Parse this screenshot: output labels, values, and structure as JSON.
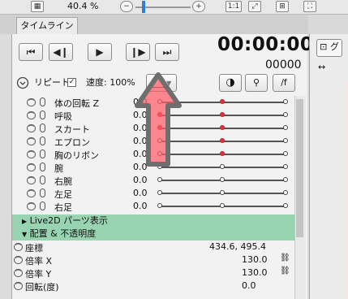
{
  "toolbar": {
    "zoom_label": "40.4 %",
    "ratio_label": "1:1"
  },
  "tabs": {
    "timeline": "タイムライン"
  },
  "player": {
    "timecode": "00:00:00",
    "frame": "00000"
  },
  "options": {
    "repeat_label": "リピート",
    "speed_label": "速度: 100%",
    "f_label": "/f"
  },
  "tracks": [
    {
      "label": "体の回転 Z",
      "value": "0.0"
    },
    {
      "label": "呼吸",
      "value": "0.0"
    },
    {
      "label": "スカート",
      "value": "0.0"
    },
    {
      "label": "エプロン",
      "value": "0.0"
    },
    {
      "label": "胸のリボン",
      "value": "0.0"
    },
    {
      "label": "腕",
      "value": "0.0"
    },
    {
      "label": "右腕",
      "value": "0.0"
    },
    {
      "label": "左足",
      "value": "0.0"
    },
    {
      "label": "右足",
      "value": "0.0"
    }
  ],
  "sections": {
    "live2d": "Live2D パーツ表示",
    "placement": "配置 & 不透明度"
  },
  "properties": [
    {
      "label": "座標",
      "value": "434.6,  495.4"
    },
    {
      "label": "倍率 X",
      "value": "130.0"
    },
    {
      "label": "倍率 Y",
      "value": "130.0"
    },
    {
      "label": "回転(度)",
      "value": "0.0"
    }
  ],
  "colors": {
    "accent_red": "#e8303a",
    "section_green": "#99d4b2",
    "arrow_gray": "#7a7a7a"
  }
}
